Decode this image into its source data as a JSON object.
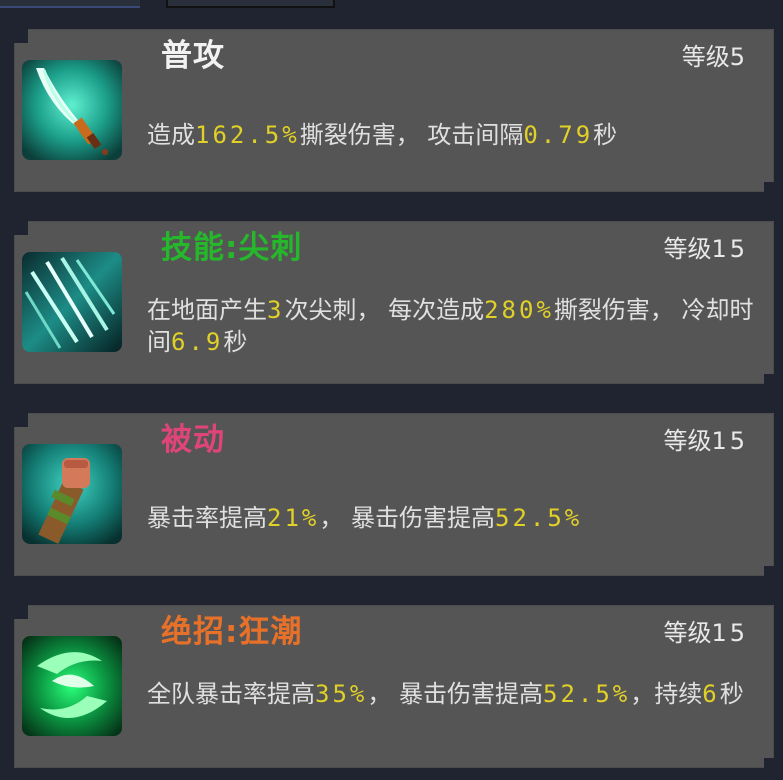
{
  "colors": {
    "background": "#1f2430",
    "panel": "#555555",
    "text": "#e0e0e0",
    "highlight": "#e0d028",
    "title_white": "#f2f2f2",
    "title_green": "#25b82a",
    "title_pink": "#e0457a",
    "title_orange": "#e8712a"
  },
  "skills": [
    {
      "icon": "blade-slash-icon",
      "title": "普攻",
      "level_label": "等级",
      "level": "5",
      "desc": [
        {
          "t": "造成"
        },
        {
          "t": "162.5%",
          "hl": true
        },
        {
          "t": "撕裂伤害， 攻击间隔"
        },
        {
          "t": "0.79",
          "hl": true
        },
        {
          "t": "秒"
        }
      ]
    },
    {
      "icon": "spike-claws-icon",
      "title": "技能:尖刺",
      "level_label": "等级",
      "level": "15",
      "desc": [
        {
          "t": "在地面产生"
        },
        {
          "t": "3",
          "hl": true
        },
        {
          "t": "次尖刺， 每次造成"
        },
        {
          "t": "280%",
          "hl": true
        },
        {
          "t": "撕裂伤害， 冷却时间"
        },
        {
          "t": "6.9",
          "hl": true
        },
        {
          "t": "秒"
        }
      ]
    },
    {
      "icon": "fist-icon",
      "title": "被动",
      "level_label": "等级",
      "level": "15",
      "desc": [
        {
          "t": "暴击率提高"
        },
        {
          "t": "21%",
          "hl": true
        },
        {
          "t": "， 暴击伤害提高"
        },
        {
          "t": "52.5%",
          "hl": true
        }
      ]
    },
    {
      "icon": "green-vortex-icon",
      "title": "绝招:狂潮",
      "level_label": "等级",
      "level": "15",
      "desc": [
        {
          "t": "全队暴击率提高"
        },
        {
          "t": "35%",
          "hl": true
        },
        {
          "t": "， 暴击伤害提高"
        },
        {
          "t": "52.5%",
          "hl": true
        },
        {
          "t": "，持续"
        },
        {
          "t": "6",
          "hl": true
        },
        {
          "t": "秒"
        }
      ]
    }
  ]
}
